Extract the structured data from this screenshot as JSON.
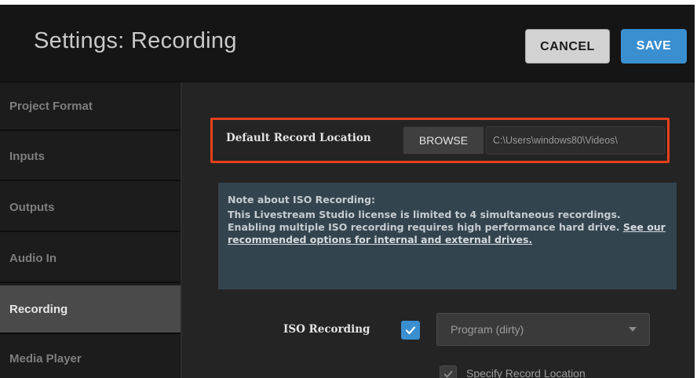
{
  "header": {
    "title": "Settings: Recording",
    "cancel_label": "CANCEL",
    "save_label": "SAVE"
  },
  "sidebar": {
    "items": [
      {
        "label": "Project Format",
        "active": false
      },
      {
        "label": "Inputs",
        "active": false
      },
      {
        "label": "Outputs",
        "active": false
      },
      {
        "label": "Audio In",
        "active": false
      },
      {
        "label": "Recording",
        "active": true
      },
      {
        "label": "Media Player",
        "active": false
      }
    ]
  },
  "record_location": {
    "label": "Default Record Location",
    "browse_label": "BROWSE",
    "path_value": "C:\\Users\\windows80\\Videos\\"
  },
  "note": {
    "heading": "Note about ISO Recording:",
    "body": "This Livestream Studio license is limited to 4 simultaneous recordings. Enabling multiple ISO recording requires high performance hard drive. ",
    "link_text": "See our recommended options for internal and external drives."
  },
  "iso_recording": {
    "label": "ISO Recording",
    "checked": true,
    "selected_option": "Program (dirty)"
  },
  "specify_location": {
    "label": "Specify Record Location",
    "checked": true
  },
  "colors": {
    "accent": "#3a8fd0",
    "highlight_border": "#e8401c",
    "note_background": "#34444f"
  },
  "icons": {
    "select_arrow": "caret-down-icon",
    "checkbox": "checkmark-icon"
  }
}
